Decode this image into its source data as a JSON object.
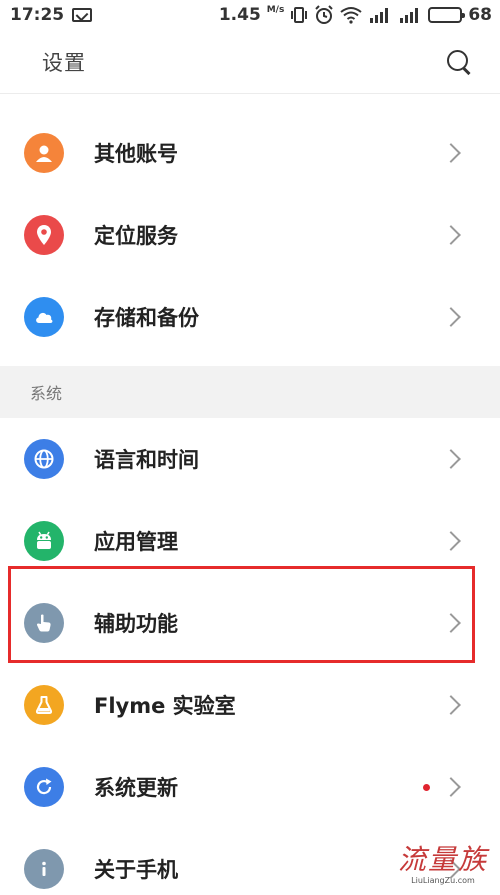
{
  "status_bar": {
    "time": "17:25",
    "speed_value": "1.45",
    "speed_unit": "M/s",
    "battery": "68",
    "battery_level": 0.68
  },
  "header": {
    "title": "设置"
  },
  "items_top": [
    {
      "label": "其他账号",
      "icon": "person-icon",
      "color": "#f5843a"
    },
    {
      "label": "定位服务",
      "icon": "location-pin-icon",
      "color": "#ea4a4a"
    },
    {
      "label": "存储和备份",
      "icon": "cloud-icon",
      "color": "#2f8ef0"
    }
  ],
  "section": {
    "label": "系统"
  },
  "items_system": [
    {
      "label": "语言和时间",
      "icon": "globe-icon",
      "color": "#3d7ee6"
    },
    {
      "label": "应用管理",
      "icon": "android-icon",
      "color": "#23b46a"
    },
    {
      "label": "辅助功能",
      "icon": "hand-pointer-icon",
      "color": "#7f98ae"
    },
    {
      "label": "Flyme 实验室",
      "icon": "flask-icon",
      "color": "#f3a621"
    },
    {
      "label": "系统更新",
      "icon": "refresh-icon",
      "color": "#3d7ee6",
      "badge": true
    },
    {
      "label": "关于手机",
      "icon": "info-icon",
      "color": "#7f98ae"
    }
  ],
  "watermark": {
    "text": "流量族",
    "url": "LiuLiangZu.com"
  }
}
